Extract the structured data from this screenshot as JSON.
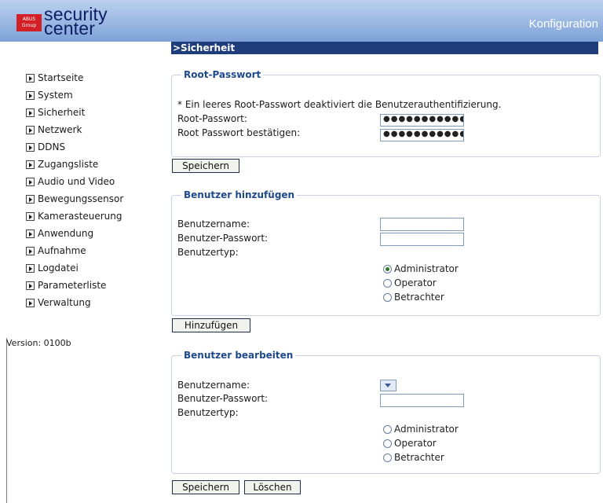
{
  "header": {
    "logo_box_line1": "ABUS",
    "logo_box_line2": "Group",
    "logo_line1": "security",
    "logo_line2": "center",
    "title": "Konfiguration"
  },
  "sidebar": {
    "items": [
      {
        "label": "Startseite"
      },
      {
        "label": "System"
      },
      {
        "label": "Sicherheit"
      },
      {
        "label": "Netzwerk"
      },
      {
        "label": "DDNS"
      },
      {
        "label": "Zugangsliste"
      },
      {
        "label": "Audio und Video"
      },
      {
        "label": "Bewegungssensor"
      },
      {
        "label": "Kamerasteuerung"
      },
      {
        "label": "Anwendung"
      },
      {
        "label": "Aufnahme"
      },
      {
        "label": "Logdatei"
      },
      {
        "label": "Parameterliste"
      },
      {
        "label": "Verwaltung"
      }
    ],
    "version": "Version: 0100b"
  },
  "page": {
    "section_title": ">Sicherheit"
  },
  "root_password": {
    "legend": "Root-Passwort",
    "note": "* Ein leeres Root-Passwort deaktiviert die Benutzerauthentifizierung.",
    "password_label": "Root-Passwort:",
    "confirm_label": "Root Passwort bestätigen:",
    "password_value": "●●●●●●●●●●●●●●",
    "confirm_value": "●●●●●●●●●●●●●●",
    "save_label": "Speichern"
  },
  "add_user": {
    "legend": "Benutzer hinzufügen",
    "username_label": "Benutzername:",
    "password_label": "Benutzer-Passwort:",
    "type_label": "Benutzertyp:",
    "types": [
      "Administrator",
      "Operator",
      "Betrachter"
    ],
    "selected_type": "Administrator",
    "add_label": "Hinzufügen"
  },
  "edit_user": {
    "legend": "Benutzer bearbeiten",
    "username_label": "Benutzername:",
    "password_label": "Benutzer-Passwort:",
    "type_label": "Benutzertyp:",
    "types": [
      "Administrator",
      "Operator",
      "Betrachter"
    ],
    "save_label": "Speichern",
    "delete_label": "Löschen"
  }
}
